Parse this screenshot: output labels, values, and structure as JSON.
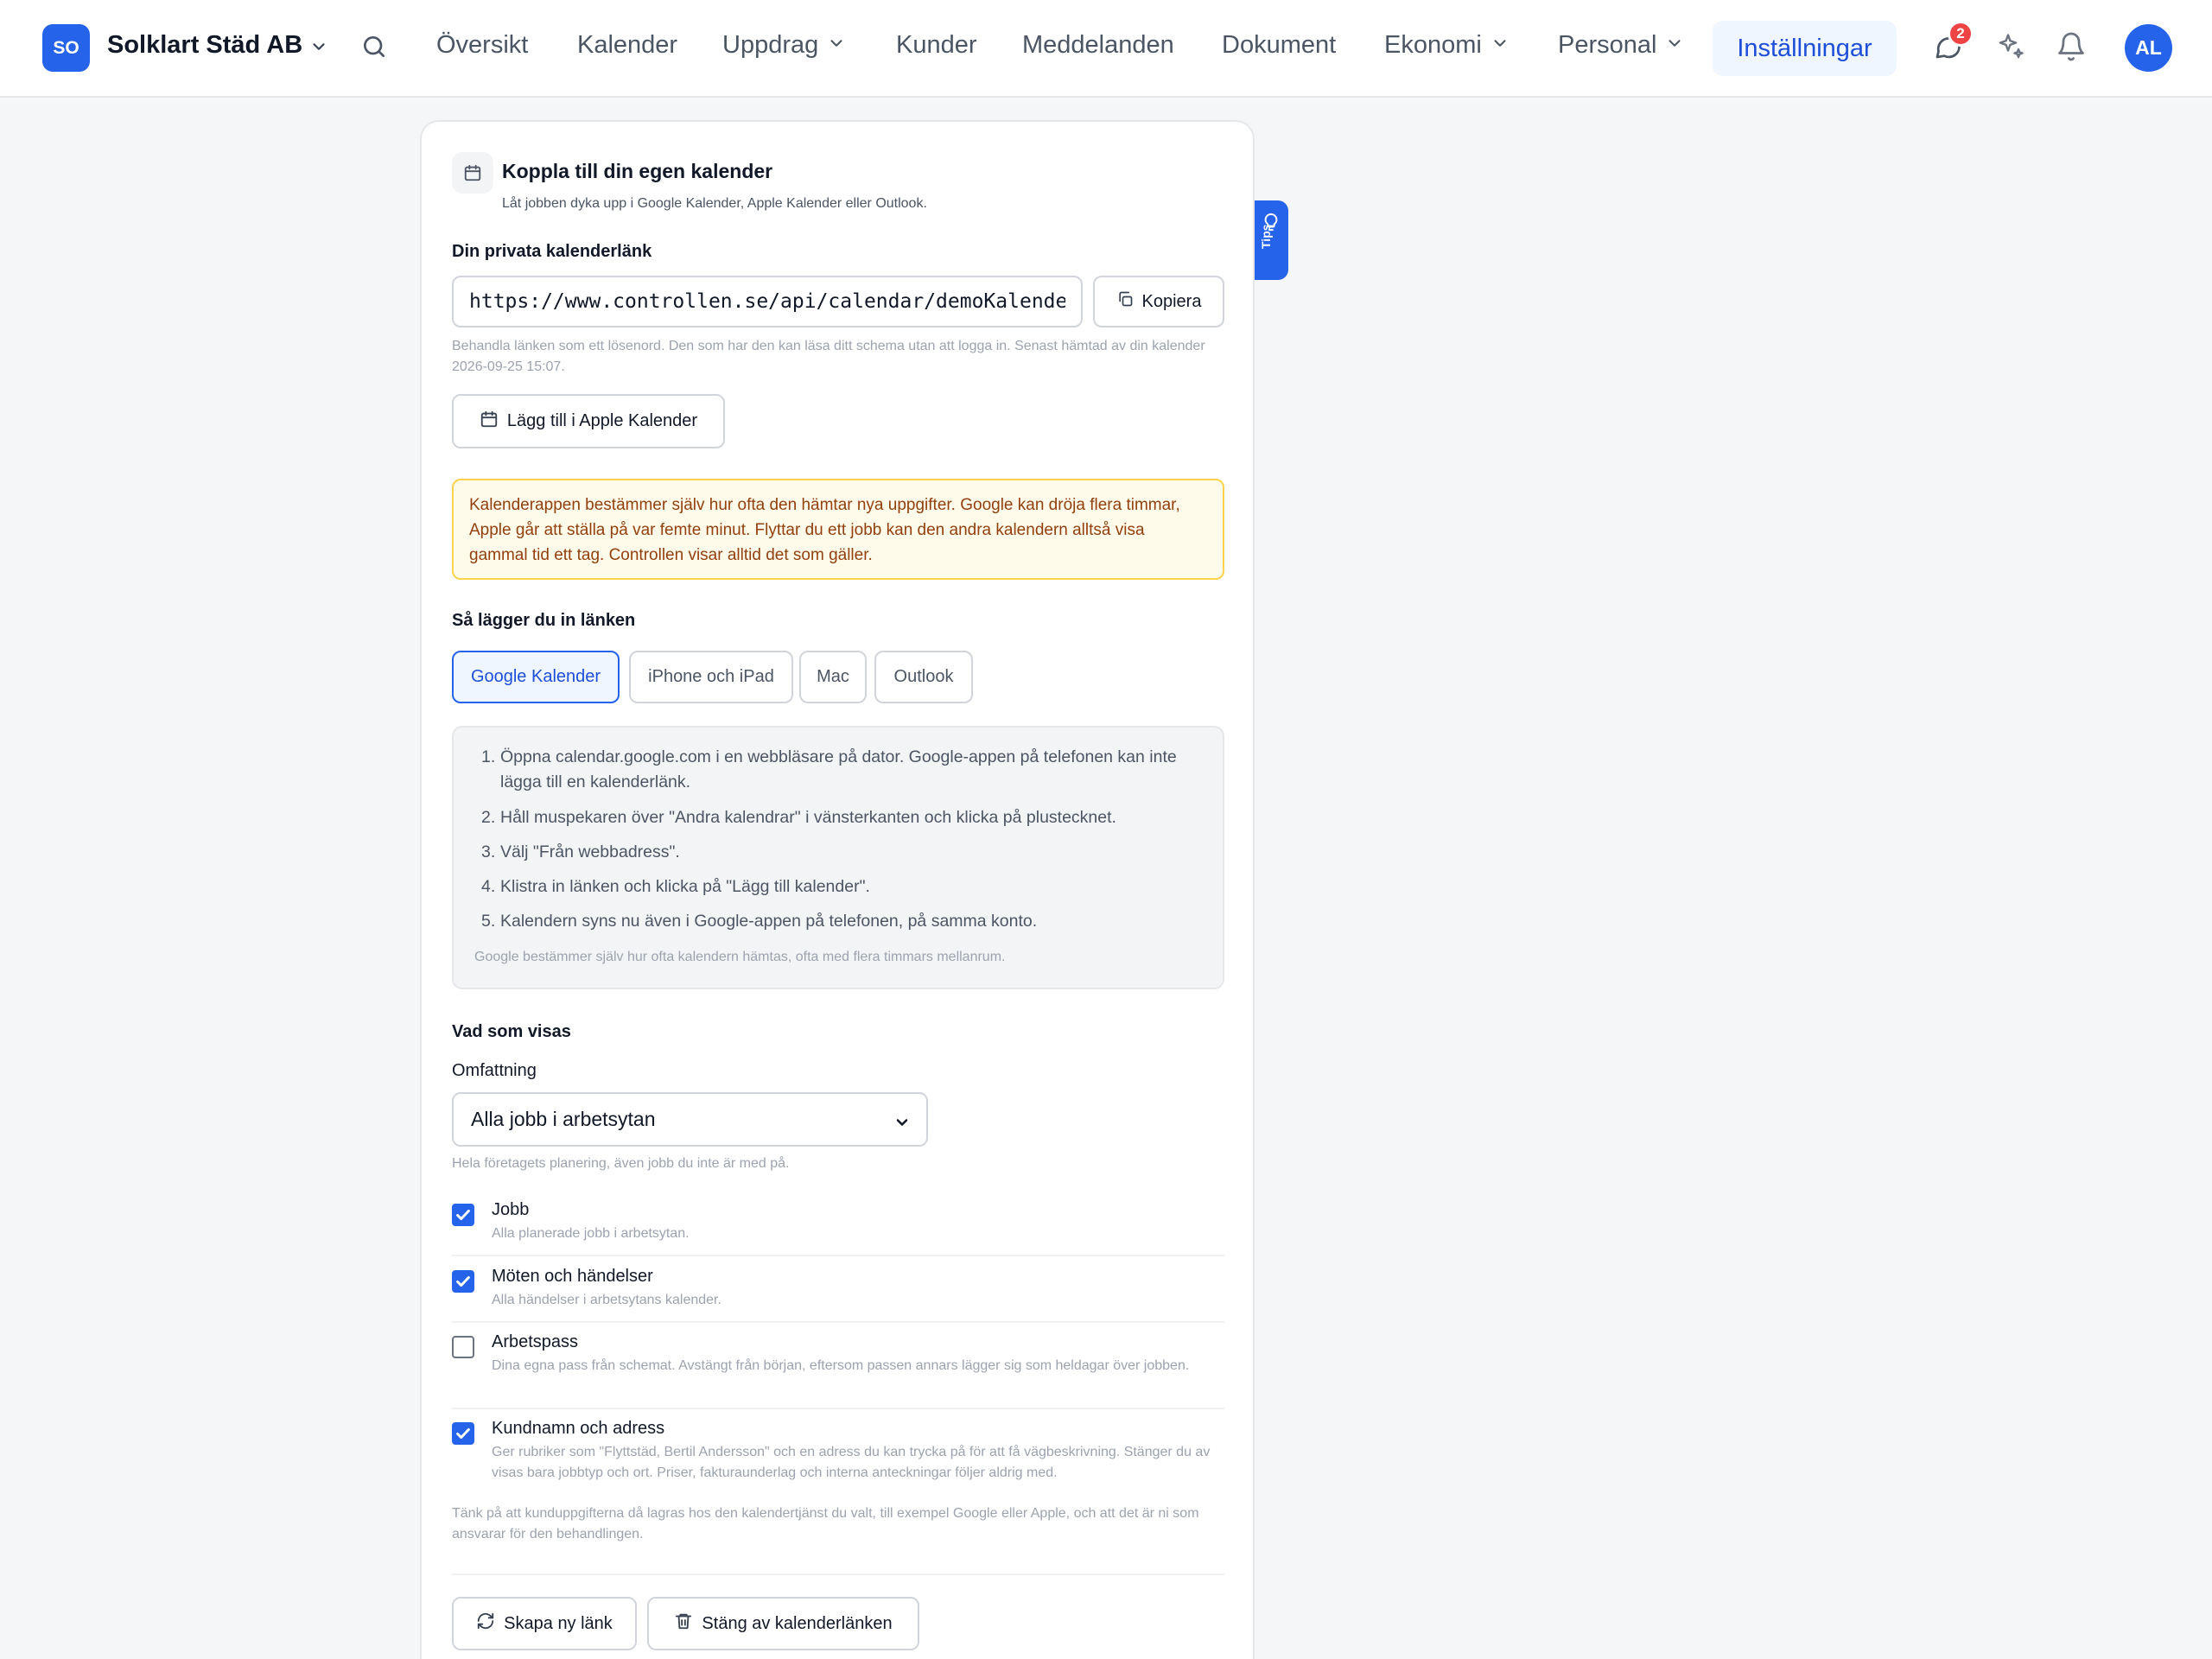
{
  "nav": {
    "brand_initials": "SO",
    "brand_name": "Solklart Städ AB",
    "items": [
      "Översikt",
      "Kalender",
      "Uppdrag",
      "Kunder",
      "Meddelanden",
      "Dokument",
      "Ekonomi",
      "Personal"
    ],
    "active_item": "Inställningar",
    "notification_count": "2",
    "avatar_initials": "AL"
  },
  "tips_label": "Tips",
  "card": {
    "title": "Koppla till din egen kalender",
    "subtitle": "Låt jobben dyka upp i Google Kalender, Apple Kalender eller Outlook.",
    "link_label": "Din privata kalenderlänk",
    "link_value": "https://www.controllen.se/api/calendar/demoKalende",
    "copy_button": "Kopiera",
    "link_hint": "Behandla länken som ett lösenord. Den som har den kan läsa ditt schema utan att logga in. Senast hämtad av din kalender 2026-09-25 15:07.",
    "apple_button": "Lägg till i Apple Kalender",
    "warning": "Kalenderappen bestämmer själv hur ofta den hämtar nya uppgifter. Google kan dröja flera timmar, Apple går att ställa på var femte minut. Flyttar du ett jobb kan den andra kalendern alltså visa gammal tid ett tag. Controllen visar alltid det som gäller.",
    "howto_heading": "Så lägger du in länken",
    "tabs": [
      "Google Kalender",
      "iPhone och iPad",
      "Mac",
      "Outlook"
    ],
    "steps": [
      "Öppna calendar.google.com i en webbläsare på dator. Google-appen på telefonen kan inte lägga till en kalenderlänk.",
      "Håll muspekaren över \"Andra kalendrar\" i vänsterkanten och klicka på plustecknet.",
      "Välj \"Från webbadress\".",
      "Klistra in länken och klicka på \"Lägg till kalender\".",
      "Kalendern syns nu även i Google-appen på telefonen, på samma konto."
    ],
    "steps_note": "Google bestämmer själv hur ofta kalendern hämtas, ofta med flera timmars mellanrum.",
    "shown_heading": "Vad som visas",
    "scope_label": "Omfattning",
    "scope_value": "Alla jobb i arbetsytan",
    "scope_hint": "Hela företagets planering, även jobb du inte är med på.",
    "options": [
      {
        "title": "Jobb",
        "desc": "Alla planerade jobb i arbetsytan.",
        "checked": true
      },
      {
        "title": "Möten och händelser",
        "desc": "Alla händelser i arbetsytans kalender.",
        "checked": true
      },
      {
        "title": "Arbetspass",
        "desc": "Dina egna pass från schemat. Avstängt från början, eftersom passen annars lägger sig som heldagar över jobben.",
        "checked": false
      },
      {
        "title": "Kundnamn och adress",
        "desc": "Ger rubriker som \"Flyttstäd, Bertil Andersson\" och en adress du kan trycka på för att få vägbeskrivning. Stänger du av visas bara jobbtyp och ort. Priser, fakturaunderlag och interna anteckningar följer aldrig med.",
        "checked": true
      }
    ],
    "privacy_note": "Tänk på att kunduppgifterna då lagras hos den kalendertjänst du valt, till exempel Google eller Apple, och att det är ni som ansvarar för den behandlingen.",
    "new_link_button": "Skapa ny länk",
    "disable_button": "Stäng av kalenderlänken"
  },
  "colors": {
    "accent": "#2563eb",
    "warning_bg": "#fffbeb",
    "warning_border": "#fcd34d",
    "warning_text": "#92400e",
    "badge": "#ef4444"
  }
}
